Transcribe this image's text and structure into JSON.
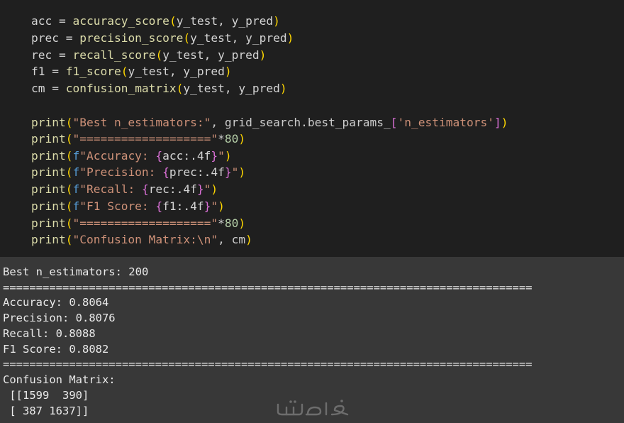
{
  "code": {
    "l1": {
      "a": "acc",
      "b": " = ",
      "fn": "accuracy_score",
      "args": "y_test, y_pred"
    },
    "l2": {
      "a": "prec",
      "b": " = ",
      "fn": "precision_score",
      "args": "y_test, y_pred"
    },
    "l3": {
      "a": "rec",
      "b": " = ",
      "fn": "recall_score",
      "args": "y_test, y_pred"
    },
    "l4": {
      "a": "f1",
      "b": " = ",
      "fn": "f1_score",
      "args": "y_test, y_pred"
    },
    "l5": {
      "a": "cm",
      "b": " = ",
      "fn": "confusion_matrix",
      "args": "y_test, y_pred"
    },
    "print_kw": "print",
    "p1_str": "\"Best n_estimators:\"",
    "p1_rest": ", grid_search.best_params_",
    "p1_key": "'n_estimators'",
    "p2_str": "\"===================\"",
    "p2_mul": "*",
    "p2_num": "80",
    "p3_f": "f",
    "p3_str1": "\"Accuracy: ",
    "p3_expr": "acc:.4f",
    "p3_str2": "\"",
    "p4_f": "f",
    "p4_str1": "\"Precision: ",
    "p4_expr": "prec:.4f",
    "p4_str2": "\"",
    "p5_f": "f",
    "p5_str1": "\"Recall: ",
    "p5_expr": "rec:.4f",
    "p5_str2": "\"",
    "p6_f": "f",
    "p6_str1": "\"F1 Score: ",
    "p6_expr": "f1:.4f",
    "p6_str2": "\"",
    "p7_str": "\"===================\"",
    "p7_mul": "*",
    "p7_num": "80",
    "p8_str": "\"Confusion Matrix:\\n\"",
    "p8_rest": ", cm"
  },
  "output": {
    "best": "Best n_estimators: 200",
    "rule": "================================================================================",
    "accuracy": "Accuracy: 0.8064",
    "precision": "Precision: 0.8076",
    "recall": "Recall: 0.8088",
    "f1": "F1 Score: 0.8082",
    "cm_title": "Confusion Matrix:",
    "cm_row1": " [[1599  390]",
    "cm_row2": " [ 387 1637]]"
  },
  "watermark": {
    "text": "خمسات"
  },
  "colors": {
    "editor_bg": "#1f1f1f",
    "output_bg": "#383838",
    "function": "#dcdcaa",
    "string": "#ce9178",
    "number": "#b5cea8",
    "bracket_level1": "#ffd700",
    "bracket_level2": "#da70d6",
    "bracket_level3": "#179fff"
  }
}
